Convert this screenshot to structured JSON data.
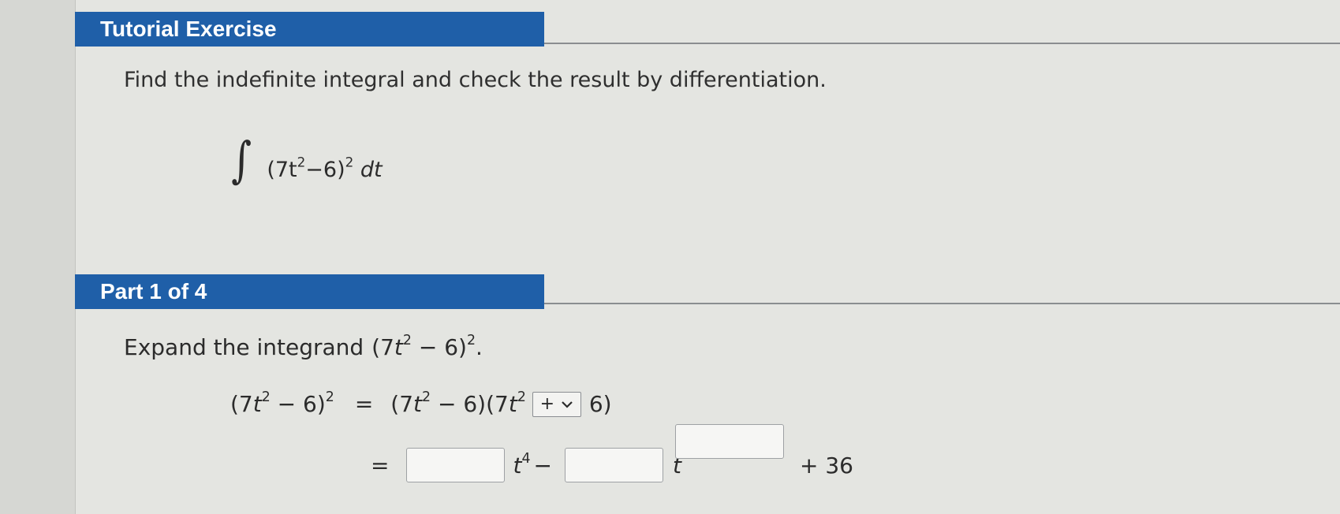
{
  "tutorial": {
    "header": "Tutorial Exercise",
    "prompt": "Find the indefinite integral and check the result by differentiation.",
    "integral_sign": "∫",
    "integral_base": "(7t",
    "integral_exp1": "2",
    "integral_mid": "−6)",
    "integral_exp2": "2",
    "integral_tail": " dt"
  },
  "part": {
    "header": "Part 1 of 4",
    "instruction_text": "Expand the integrand ",
    "instruction_expr_a": "(7",
    "instruction_expr_t": "t",
    "instruction_expr_exp1": "2",
    "instruction_expr_b": " − 6)",
    "instruction_expr_exp2": "2",
    "instruction_expr_end": "."
  },
  "equation": {
    "lhs_a": "(7",
    "lhs_t": "t",
    "lhs_exp1": "2",
    "lhs_b": " − 6)",
    "lhs_exp2": "2",
    "equals": "=",
    "rhs_a": "(7",
    "rhs_t": "t",
    "rhs_exp": "2",
    "rhs_b": " − 6)(7",
    "rhs_t2": "t",
    "rhs_exp2": "2",
    "dropdown_value": "+",
    "rhs_c": "6)",
    "line2_equals": "=",
    "t4_t": "t",
    "t4_exp": "4",
    "minus": " −",
    "t_var": "t",
    "plus_const": "+ 36"
  }
}
